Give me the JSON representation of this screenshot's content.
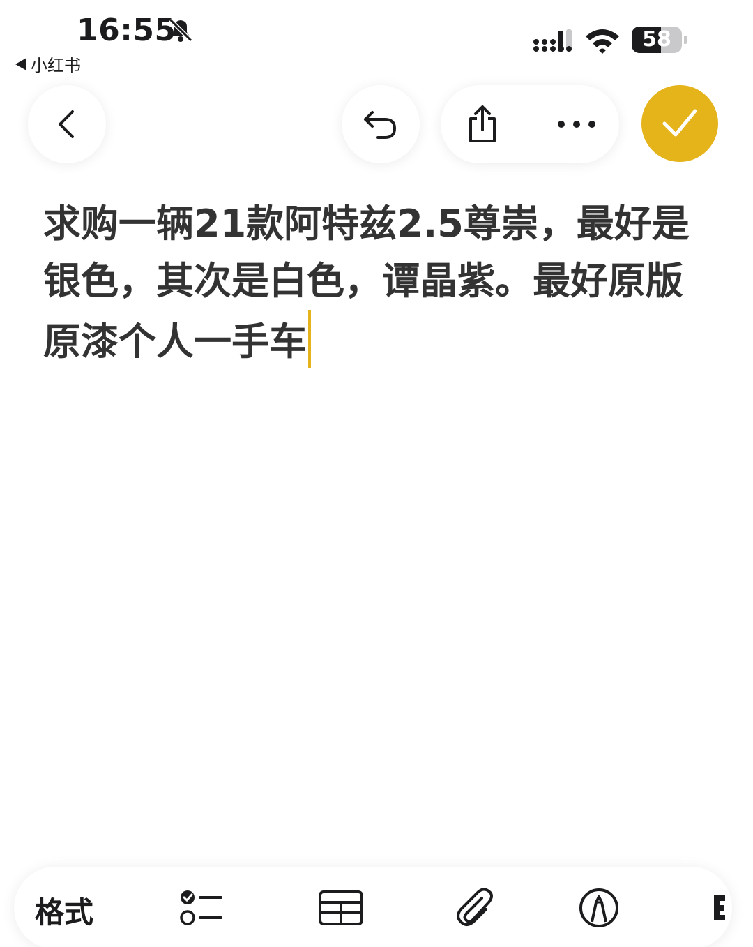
{
  "status_bar": {
    "time": "16:55",
    "back_app": "小红书",
    "battery": 58,
    "icons": [
      "bell-slash-icon",
      "cellular-signal-icon",
      "wifi-icon",
      "battery-icon"
    ]
  },
  "top_toolbar": {
    "icons": [
      "chevron-left-icon",
      "undo-icon",
      "share-icon",
      "more-icon",
      "checkmark-icon"
    ],
    "accent_color": "#e5b31a"
  },
  "note": {
    "text": "求购一辆21款阿特兹2.5尊崇，最好是银色，其次是白色，谭晶紫。最好原版原漆个人一手车"
  },
  "bottom_toolbar": {
    "format_label": "格式",
    "icons": [
      "checklist-icon",
      "table-icon",
      "paperclip-icon",
      "markup-pen-icon"
    ]
  }
}
